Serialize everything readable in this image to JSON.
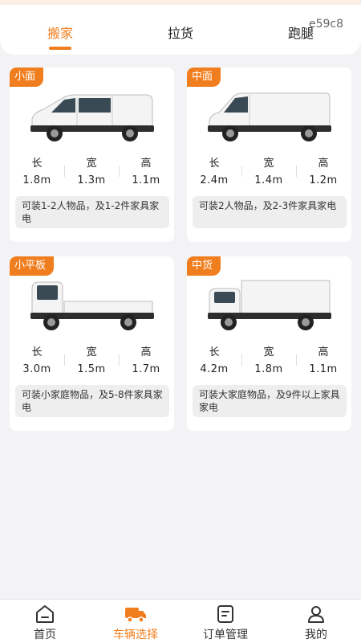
{
  "header": {
    "tabs": [
      {
        "label": "搬家"
      },
      {
        "label": "拉货"
      },
      {
        "label": "跑腿"
      }
    ],
    "code": "e59c8"
  },
  "cards": [
    {
      "tag": "小面",
      "dims": {
        "length_label": "长",
        "length": "1.8m",
        "width_label": "宽",
        "width": "1.3m",
        "height_label": "高",
        "height": "1.1m"
      },
      "desc": "可装1-2人物品，及1-2件家具家电",
      "vehicle_icon": "small-van-icon"
    },
    {
      "tag": "中面",
      "dims": {
        "length_label": "长",
        "length": "2.4m",
        "width_label": "宽",
        "width": "1.4m",
        "height_label": "高",
        "height": "1.2m"
      },
      "desc": "可装2人物品，及2-3件家具家电",
      "vehicle_icon": "medium-van-icon"
    },
    {
      "tag": "小平板",
      "dims": {
        "length_label": "长",
        "length": "3.0m",
        "width_label": "宽",
        "width": "1.5m",
        "height_label": "高",
        "height": "1.7m"
      },
      "desc": "可装小家庭物品，及5-8件家具家电",
      "vehicle_icon": "flatbed-truck-icon"
    },
    {
      "tag": "中货",
      "dims": {
        "length_label": "长",
        "length": "4.2m",
        "width_label": "宽",
        "width": "1.8m",
        "height_label": "高",
        "height": "1.1m"
      },
      "desc": "可装大家庭物品，及9件以上家具家电",
      "vehicle_icon": "box-truck-icon"
    }
  ],
  "nav": [
    {
      "label": "首页",
      "icon": "home-icon"
    },
    {
      "label": "车辆选择",
      "icon": "truck-icon"
    },
    {
      "label": "订单管理",
      "icon": "order-icon"
    },
    {
      "label": "我的",
      "icon": "profile-icon"
    }
  ],
  "colors": {
    "accent": "#f07e1e",
    "background": "#f3f3f5"
  }
}
